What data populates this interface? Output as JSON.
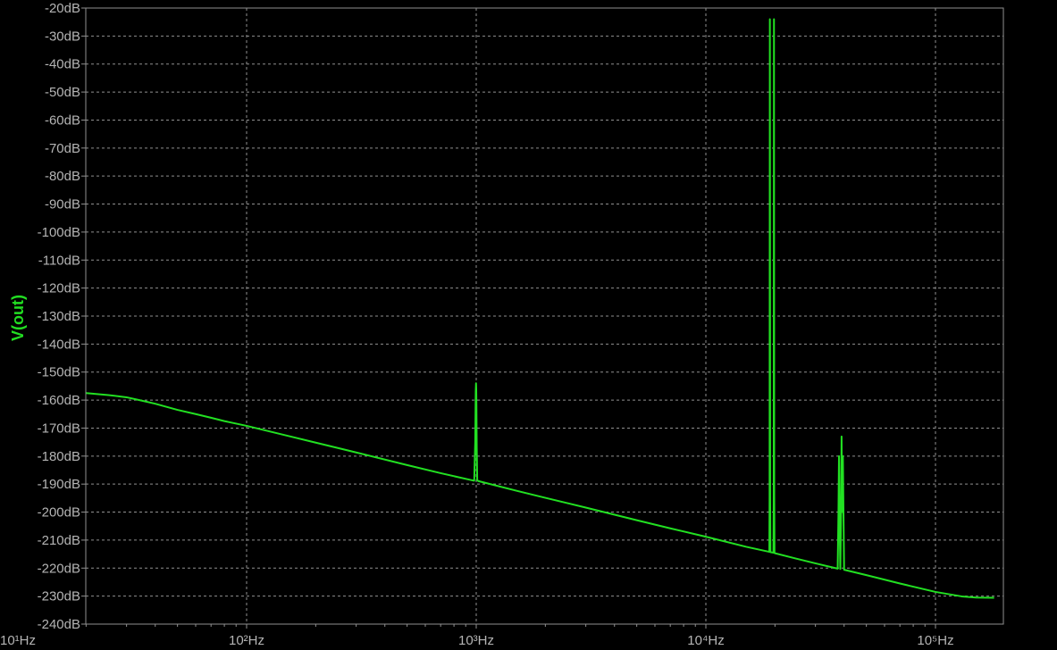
{
  "chart_data": {
    "type": "line",
    "title": "",
    "xlabel": "",
    "ylabel": "V(out)",
    "x_scale": "log",
    "xlim_hz": [
      20,
      180000
    ],
    "ylim_db": [
      -240,
      -20
    ],
    "grid": true,
    "x_tick_labels": [
      {
        "hz": 10,
        "label": "10¹Hz"
      },
      {
        "hz": 100,
        "label": "10²Hz"
      },
      {
        "hz": 1000,
        "label": "10³Hz"
      },
      {
        "hz": 10000,
        "label": "10⁴Hz"
      },
      {
        "hz": 100000,
        "label": "10⁵Hz"
      }
    ],
    "y_ticks_db": [
      -20,
      -30,
      -40,
      -50,
      -60,
      -70,
      -80,
      -90,
      -100,
      -110,
      -120,
      -130,
      -140,
      -150,
      -160,
      -170,
      -180,
      -190,
      -200,
      -210,
      -220,
      -230,
      -240
    ],
    "y_tick_unit": "dB",
    "colors": {
      "background": "#000000",
      "grid": "#909090",
      "trace": "#22e022",
      "tick_text": "#b4b4b4",
      "axis_frame": "#909090"
    },
    "series": [
      {
        "name": "V(out)",
        "x_hz": [
          20,
          25,
          30,
          35,
          40,
          50,
          60,
          70,
          80,
          100,
          150,
          200,
          300,
          500,
          700,
          980,
          990,
          995,
          998,
          1000,
          1002,
          1005,
          1010,
          1020,
          1500,
          2000,
          3000,
          5000,
          7000,
          10000,
          15000,
          18900,
          18950,
          19000,
          19050,
          19100,
          19700,
          19750,
          19800,
          19850,
          19900,
          20000,
          25000,
          30000,
          37500,
          37800,
          38000,
          38200,
          38500,
          38800,
          39000,
          39200,
          39500,
          40000,
          50000,
          70000,
          100000,
          130000,
          150000,
          180000
        ],
        "y_db": [
          -157.5,
          -158.2,
          -159,
          -160.2,
          -161.3,
          -163.5,
          -165,
          -166.3,
          -167.5,
          -169.2,
          -172.7,
          -175.2,
          -178.7,
          -183.2,
          -186.1,
          -188.8,
          -175,
          -157,
          -154,
          -156,
          -162,
          -177,
          -188.6,
          -188.9,
          -192.4,
          -194.9,
          -198.4,
          -202.9,
          -205.8,
          -208.8,
          -212.4,
          -214.2,
          -194,
          -24,
          -194,
          -214.3,
          -214.5,
          -194,
          -24,
          -194,
          -214.6,
          -214.7,
          -216.7,
          -218.3,
          -220.2,
          -200,
          -180,
          -200,
          -220.3,
          -200,
          -173,
          -200,
          -180,
          -220.6,
          -222.5,
          -225.5,
          -228.5,
          -230.1,
          -230.5,
          -230.6
        ]
      }
    ]
  }
}
